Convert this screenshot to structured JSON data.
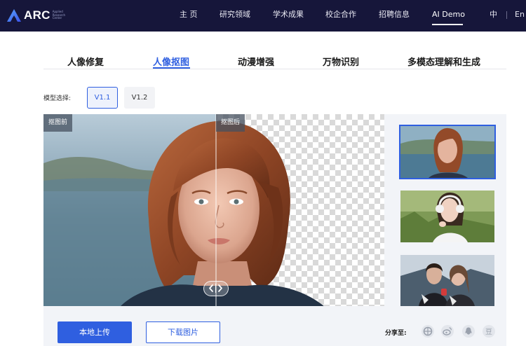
{
  "brand": {
    "name": "ARC",
    "subtitle": "Applied Research Center"
  },
  "nav": {
    "items": [
      {
        "label": "主 页"
      },
      {
        "label": "研究领域"
      },
      {
        "label": "学术成果"
      },
      {
        "label": "校企合作"
      },
      {
        "label": "招聘信息"
      },
      {
        "label": "AI Demo",
        "active": true
      }
    ],
    "lang_zh": "中",
    "lang_en": "En"
  },
  "tabs": [
    {
      "label": "人像修复"
    },
    {
      "label": "人像抠图",
      "active": true
    },
    {
      "label": "动漫增强"
    },
    {
      "label": "万物识别"
    },
    {
      "label": "多模态理解和生成"
    }
  ],
  "model": {
    "label": "模型选择:",
    "versions": [
      {
        "label": "V1.1",
        "selected": true
      },
      {
        "label": "V1.2",
        "selected": false
      }
    ]
  },
  "compare": {
    "before_label": "抠图前",
    "after_label": "抠图后",
    "handle_icons": [
      "chevron-left-icon",
      "chevron-right-icon"
    ]
  },
  "thumbnails": [
    {
      "name": "red-hair-woman",
      "selected": true
    },
    {
      "name": "headphones-woman",
      "selected": false
    },
    {
      "name": "couple",
      "selected": false
    }
  ],
  "actions": {
    "upload_label": "本地上传",
    "download_label": "下载图片"
  },
  "share": {
    "label": "分享至:",
    "icons": [
      "wechat-moments-icon",
      "weibo-icon",
      "qq-icon",
      "douban-icon"
    ]
  },
  "colors": {
    "nav_bg": "#16163a",
    "accent": "#2f5fe0"
  }
}
